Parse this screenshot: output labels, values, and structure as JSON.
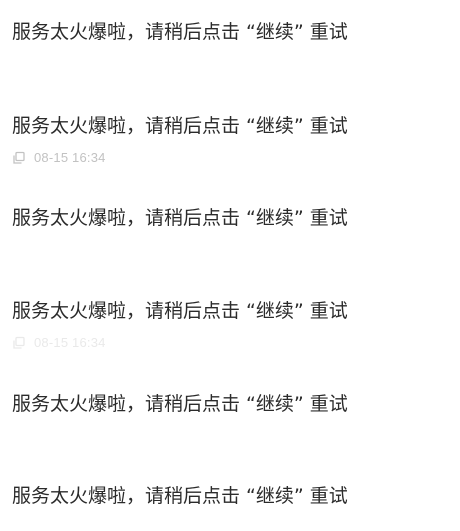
{
  "messages": [
    {
      "text": "服务太火爆啦，请稍后点击 “继续” 重试",
      "timestamp": "",
      "copy_icon": ""
    },
    {
      "text": "服务太火爆啦，请稍后点击 “继续” 重试",
      "timestamp": "08-15 16:34",
      "copy_icon": "copy-icon"
    },
    {
      "text": "服务太火爆啦，请稍后点击 “继续” 重试",
      "timestamp": "",
      "copy_icon": ""
    },
    {
      "text": "服务太火爆啦，请稍后点击 “继续” 重试",
      "timestamp": "08-15 16:34",
      "copy_icon": "copy-icon"
    },
    {
      "text": "服务太火爆啦，请稍后点击 “继续” 重试",
      "timestamp": "",
      "copy_icon": ""
    },
    {
      "text": "服务太火爆啦，请稍后点击 “继续” 重试",
      "timestamp": "",
      "copy_icon": ""
    }
  ],
  "colors": {
    "text": "#2b2b2b",
    "meta": "#c2c2c2"
  }
}
